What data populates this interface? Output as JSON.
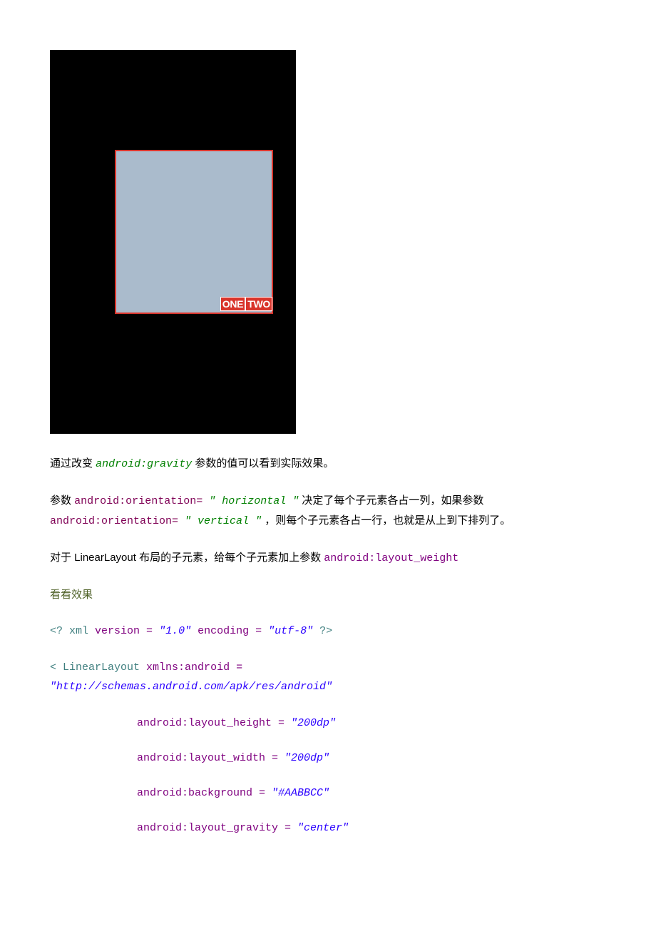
{
  "preview": {
    "badge_one": "ONE",
    "badge_two": "TWO"
  },
  "para1": {
    "t1": "通过改变 ",
    "code": "android:gravity",
    "t2": " 参数的值可以看到实际效果。"
  },
  "para2": {
    "t1": "参数 ",
    "c1": "android:orientation= ",
    "v1": "\" horizontal \"",
    "t2": " 决定了每个子元素各占一列，如果参数 ",
    "c2": "android:orientation= ",
    "v2": "\" vertical \"",
    "t3": " ，则每个子元素各占一行，也就是从上到下排列了。"
  },
  "para3": {
    "t1": "对于 LinearLayout 布局的子元素，给每个子元素加上参数 ",
    "c1": "android:layout_weight"
  },
  "heading": "看看效果",
  "xml": {
    "decl1": "<? ",
    "decl_xml": "xml",
    "decl2": " version = ",
    "decl_ver": "\"1.0\"",
    "decl3": " encoding = ",
    "decl_enc": "\"utf-8\"",
    "decl4": " ?>",
    "open1": "< ",
    "ll": "LinearLayout",
    "open2": " xmlns:android = ",
    "ns": "\"http://schemas.android.com/apk/res/android\"",
    "a1k": "android:layout_height = ",
    "a1v": "\"200dp\"",
    "a2k": "android:layout_width = ",
    "a2v": "\"200dp\"",
    "a3k": "android:background = ",
    "a3v": "\"#AABBCC\"",
    "a4k": "android:layout_gravity = ",
    "a4v": "\"center\""
  }
}
